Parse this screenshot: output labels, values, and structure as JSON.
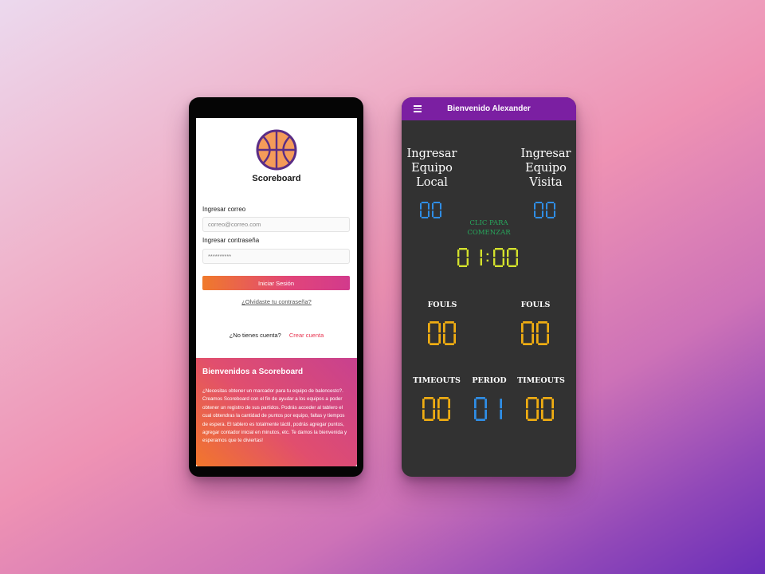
{
  "login": {
    "logo_title": "Scoreboard",
    "email_label": "Ingresar correo",
    "email_placeholder": "correo@correo.com",
    "password_label": "Ingresar contraseña",
    "password_value": "**********",
    "login_button": "Iniciar Sesión",
    "forgot_link": "¿Olvidaste tu contraseña?",
    "no_account": "¿No tienes cuenta?",
    "signup_link": "Crear cuenta",
    "welcome_title": "Bienvenidos a Scoreboard",
    "welcome_text": "¿Necesitas obtener un marcador para tu equipo de baloncesto?. Creamos Scoreboard con el fin de ayudar a los equipos a poder obtener un registro de sus partidos. Podrás acceder al tablero el cual obtendras la cantidad de puntos por equipo, faltas y tiempos de espera. El tablero es totalmente táctil, podrás agregar puntos, agregar contador inicial en minutos, etc. Te damos la bienvenida y esperamos que te diviertas!"
  },
  "board": {
    "title": "Bienvenido Alexander",
    "local_team": "Ingresar Equipo Local",
    "visit_team": "Ingresar Equipo Visita",
    "local_score": "00",
    "visit_score": "00",
    "start_hint": "CLIC PARA COMENZAR",
    "timer": "01:00",
    "fouls_label": "FOULS",
    "local_fouls": "00",
    "visit_fouls": "00",
    "timeouts_label": "TIMEOUTS",
    "period_label": "PERIOD",
    "local_timeouts": "00",
    "period": "01",
    "visit_timeouts": "00"
  },
  "colors": {
    "appbar": "#7b1fa2",
    "board_bg": "#323232",
    "score_blue": "#2f8ee6",
    "timer_yellow": "#d4e22c",
    "fouls_orange": "#f0ad12",
    "hint_green": "#27a85c",
    "login_gradient_start": "#f07a2b",
    "login_gradient_end": "#d23a8c",
    "signup_red": "#e8334f"
  },
  "icons": [
    "basketball-icon",
    "menu-icon"
  ]
}
